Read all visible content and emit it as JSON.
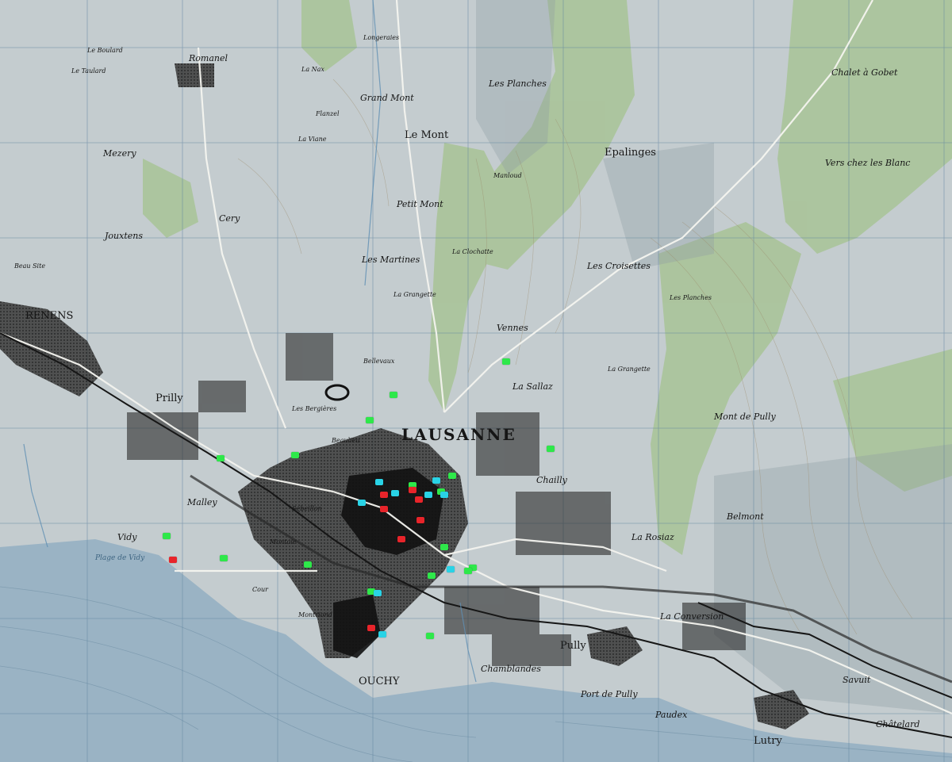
{
  "places": [
    {
      "id": "lausanne",
      "text": "LAUSANNE",
      "cls": "major"
    },
    {
      "id": "renens",
      "text": "RENENS",
      "cls": "town"
    },
    {
      "id": "prilly",
      "text": "Prilly",
      "cls": "town"
    },
    {
      "id": "pully",
      "text": "Pully",
      "cls": "town"
    },
    {
      "id": "ouchy",
      "text": "OUCHY",
      "cls": "town"
    },
    {
      "id": "lutry",
      "text": "Lutry",
      "cls": "town"
    },
    {
      "id": "le-mont",
      "text": "Le Mont",
      "cls": "town"
    },
    {
      "id": "epalinges",
      "text": "Epalinges",
      "cls": "town"
    },
    {
      "id": "belmont",
      "text": "Belmont",
      "cls": "village"
    },
    {
      "id": "romanel",
      "text": "Romanel",
      "cls": "village"
    },
    {
      "id": "jouxtens",
      "text": "Jouxtens",
      "cls": "village"
    },
    {
      "id": "mezery",
      "text": "Mezery",
      "cls": "village"
    },
    {
      "id": "cery",
      "text": "Cery",
      "cls": "village"
    },
    {
      "id": "grand-mont",
      "text": "Grand Mont",
      "cls": "village"
    },
    {
      "id": "petit-mont",
      "text": "Petit Mont",
      "cls": "village"
    },
    {
      "id": "les-martines",
      "text": "Les Martines",
      "cls": "village"
    },
    {
      "id": "les-croisettes",
      "text": "Les Croisettes",
      "cls": "village"
    },
    {
      "id": "vers-chez-les-blanc",
      "text": "Vers chez les Blanc",
      "cls": "village"
    },
    {
      "id": "chalet-a-gobet",
      "text": "Chalet à Gobet",
      "cls": "village"
    },
    {
      "id": "la-conversion",
      "text": "La Conversion",
      "cls": "village"
    },
    {
      "id": "paudex",
      "text": "Paudex",
      "cls": "village"
    },
    {
      "id": "port-de-pully",
      "text": "Port de Pully",
      "cls": "village"
    },
    {
      "id": "chamblandes",
      "text": "Chamblandes",
      "cls": "village"
    },
    {
      "id": "malley",
      "text": "Malley",
      "cls": "village"
    },
    {
      "id": "vidy",
      "text": "Vidy",
      "cls": "village"
    },
    {
      "id": "chailly",
      "text": "Chailly",
      "cls": "village"
    },
    {
      "id": "la-sallaz",
      "text": "La Sallaz",
      "cls": "village"
    },
    {
      "id": "la-rosiaz",
      "text": "La Rosiaz",
      "cls": "village"
    },
    {
      "id": "savuit",
      "text": "Savuit",
      "cls": "village"
    },
    {
      "id": "chatelard",
      "text": "Châtelard",
      "cls": "village"
    },
    {
      "id": "vennes",
      "text": "Vennes",
      "cls": "village"
    },
    {
      "id": "la-grangette",
      "text": "La Grangette",
      "cls": "small"
    },
    {
      "id": "la-clochatte",
      "text": "La Clochatte",
      "cls": "small"
    },
    {
      "id": "les-planches",
      "text": "Les Planches",
      "cls": "village"
    },
    {
      "id": "bellevaux",
      "text": "Bellevaux",
      "cls": "small"
    },
    {
      "id": "les-bergieres",
      "text": "Les Bergières",
      "cls": "small"
    },
    {
      "id": "beaulieu",
      "text": "Beaulieu",
      "cls": "small"
    },
    {
      "id": "montriond",
      "text": "Montriond",
      "cls": "small"
    },
    {
      "id": "cour",
      "text": "Cour",
      "cls": "small"
    },
    {
      "id": "la-viane",
      "text": "La Viane",
      "cls": "small"
    },
    {
      "id": "manloud",
      "text": "Manloud",
      "cls": "small"
    },
    {
      "id": "flanzel",
      "text": "Flanzel",
      "cls": "small"
    },
    {
      "id": "longeraies",
      "text": "Longeraies",
      "cls": "small"
    },
    {
      "id": "le-boulard",
      "text": "Le Boulard",
      "cls": "small"
    },
    {
      "id": "le-taulard",
      "text": "Le Taulard",
      "cls": "small"
    },
    {
      "id": "la-nax",
      "text": "La Nax",
      "cls": "small"
    },
    {
      "id": "la-grangette-east",
      "text": "La Grangette",
      "cls": "small"
    },
    {
      "id": "montoie",
      "text": "Montoie",
      "cls": "small"
    },
    {
      "id": "sebeillon",
      "text": "Sébeillon",
      "cls": "small"
    },
    {
      "id": "plage-de-vidy",
      "text": "Plage de Vidy",
      "cls": "lake"
    },
    {
      "id": "beau-site",
      "text": "Beau Site",
      "cls": "small"
    },
    {
      "id": "les-planches-east",
      "text": "Les Planches",
      "cls": "small"
    },
    {
      "id": "mont-de-pully",
      "text": "Mont de Pully",
      "cls": "village"
    }
  ],
  "markers": [
    {
      "color": "#2ee84a"
    },
    {
      "color": "#2ee84a"
    },
    {
      "color": "#2ee84a"
    },
    {
      "color": "#2ee84a"
    },
    {
      "color": "#2ee84a"
    },
    {
      "color": "#2ee84a"
    },
    {
      "color": "#2ee84a"
    },
    {
      "color": "#2ee84a"
    },
    {
      "color": "#2ee84a"
    },
    {
      "color": "#2ee84a"
    },
    {
      "color": "#2ee84a"
    },
    {
      "color": "#2ee84a"
    },
    {
      "color": "#2ee84a"
    },
    {
      "color": "#2ee84a"
    },
    {
      "color": "#2ee84a"
    },
    {
      "color": "#2ee84a"
    },
    {
      "color": "#2ee84a"
    },
    {
      "color": "#2ee84a"
    },
    {
      "color": "#29d3e6"
    },
    {
      "color": "#29d3e6"
    },
    {
      "color": "#29d3e6"
    },
    {
      "color": "#29d3e6"
    },
    {
      "color": "#29d3e6"
    },
    {
      "color": "#29d3e6"
    },
    {
      "color": "#29d3e6"
    },
    {
      "color": "#29d3e6"
    },
    {
      "color": "#29d3e6"
    },
    {
      "color": "#e8242a"
    },
    {
      "color": "#e8242a"
    },
    {
      "color": "#e8242a"
    },
    {
      "color": "#e8242a"
    },
    {
      "color": "#e8242a"
    },
    {
      "color": "#e8242a"
    },
    {
      "color": "#e8242a"
    },
    {
      "color": "#e8242a"
    }
  ],
  "colors": {
    "lake": "#9db6c7",
    "land": "#c6cdd0",
    "forest": "#a9c39a",
    "urban": "#2a2a2a",
    "road": "#f4f4f0",
    "rail": "#1b1b1b",
    "grid": "#6e8ea6"
  }
}
